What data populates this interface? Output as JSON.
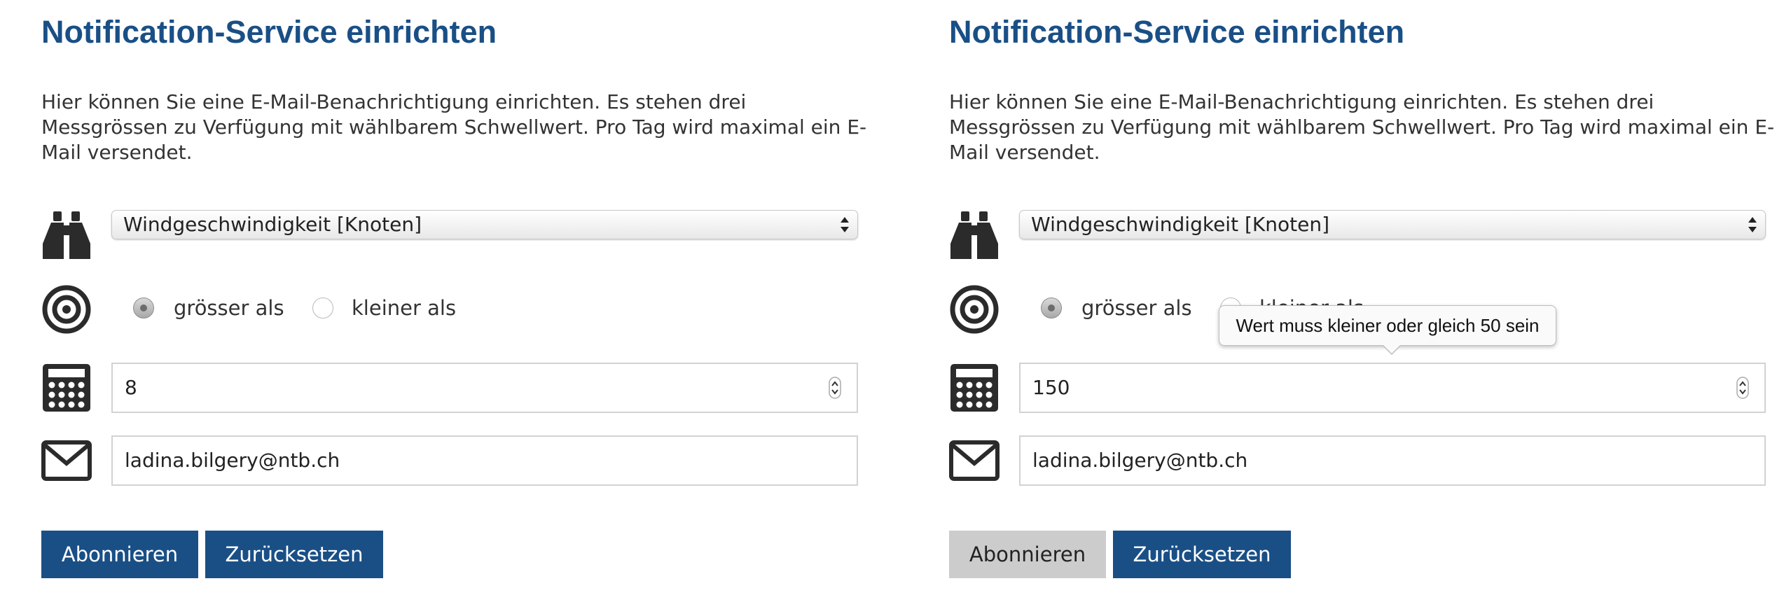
{
  "panels": [
    {
      "title": "Notification-Service einrichten",
      "description": "Hier können Sie eine E-Mail-Benachrichtigung einrichten. Es stehen drei Messgrössen zu Verfügung mit wählbarem Schwellwert. Pro Tag wird maximal ein E-Mail versendet.",
      "measure_select": "Windgeschwindigkeit [Knoten]",
      "radio_greater": "grösser als",
      "radio_smaller": "kleiner als",
      "selected_radio": "grösser als",
      "threshold_value": "8",
      "email_value": "ladina.bilgery@ntb.ch",
      "subscribe_label": "Abonnieren",
      "reset_label": "Zurücksetzen",
      "subscribe_disabled": false
    },
    {
      "title": "Notification-Service einrichten",
      "description": "Hier können Sie eine E-Mail-Benachrichtigung einrichten. Es stehen drei Messgrössen zu Verfügung mit wählbarem Schwellwert. Pro Tag wird maximal ein E-Mail versendet.",
      "measure_select": "Windgeschwindigkeit [Knoten]",
      "radio_greater": "grösser als",
      "radio_smaller": "kleiner als",
      "selected_radio": "grösser als",
      "threshold_value": "150",
      "email_value": "ladina.bilgery@ntb.ch",
      "subscribe_label": "Abonnieren",
      "reset_label": "Zurücksetzen",
      "subscribe_disabled": true,
      "validation_tooltip": "Wert muss kleiner oder gleich 50 sein"
    }
  ],
  "icons": [
    "binoculars-icon",
    "target-icon",
    "calculator-icon",
    "envelope-icon"
  ],
  "colors": {
    "accent": "#1a4f86",
    "disabled_button": "#cccccc",
    "text": "#333333"
  }
}
